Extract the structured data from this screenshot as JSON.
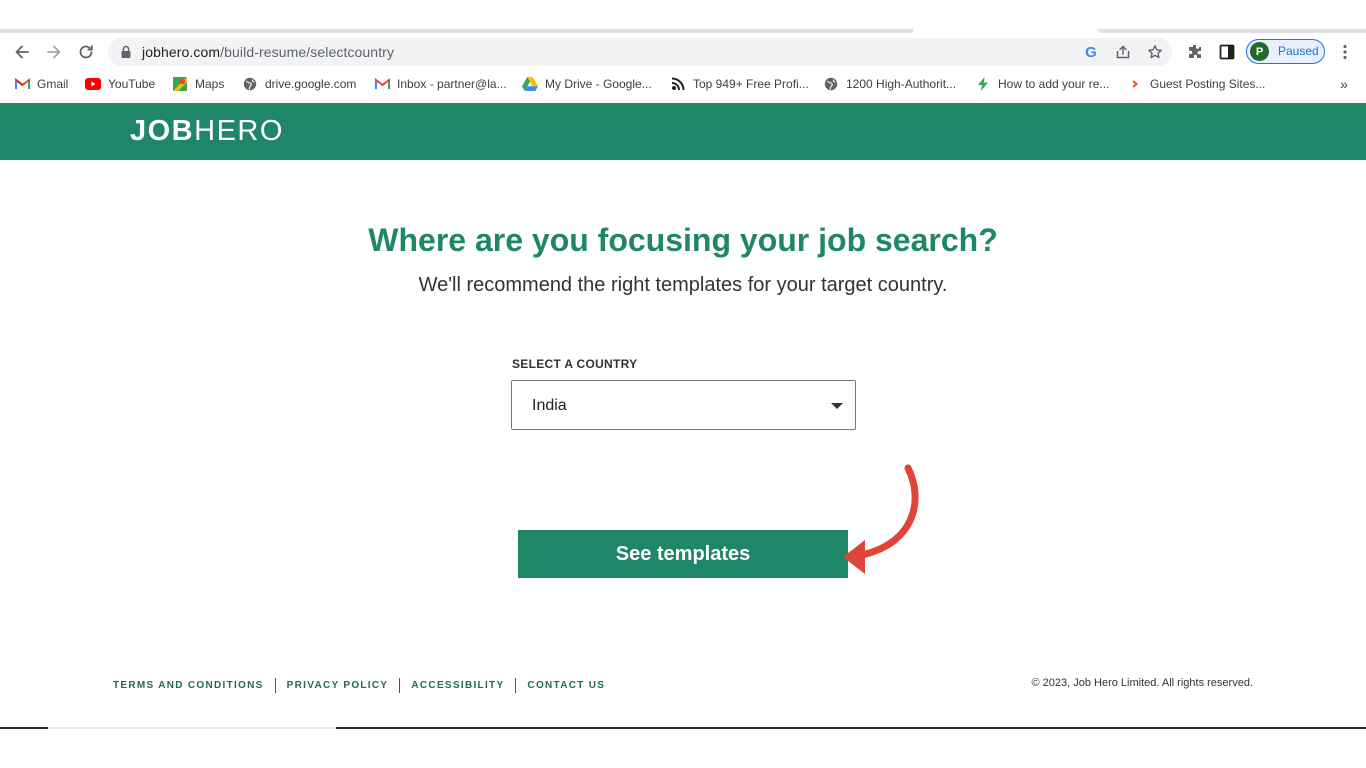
{
  "browser": {
    "url_host": "jobhero.com",
    "url_path": "/build-resume/selectcountry",
    "profile": {
      "initial": "P",
      "status": "Paused"
    },
    "bookmarks": [
      {
        "label": "Gmail",
        "icon": "gmail-icon"
      },
      {
        "label": "YouTube",
        "icon": "youtube-icon"
      },
      {
        "label": "Maps",
        "icon": "maps-icon"
      },
      {
        "label": "drive.google.com",
        "icon": "globe-icon"
      },
      {
        "label": "Inbox - partner@la...",
        "icon": "gmail-icon"
      },
      {
        "label": "My Drive - Google...",
        "icon": "google-drive-icon"
      },
      {
        "label": "Top 949+ Free Profi...",
        "icon": "rss-icon"
      },
      {
        "label": "1200 High-Authorit...",
        "icon": "globe-icon"
      },
      {
        "label": "How to add your re...",
        "icon": "bolt-icon"
      },
      {
        "label": "Guest Posting Sites...",
        "icon": "chevron-orange-icon"
      }
    ],
    "bookmarks_more": "»"
  },
  "site": {
    "logo_bold": "JOB",
    "logo_light": "HERO",
    "brand_color": "#1f8767",
    "headline": "Where are you focusing your job search?",
    "subheadline": "We'll recommend the right templates for your target country.",
    "country_label": "SELECT A COUNTRY",
    "country_value": "India",
    "cta_label": "See templates",
    "annotation_arrow_color": "#e0453a",
    "footer": {
      "links": [
        "TERMS AND CONDITIONS",
        "PRIVACY POLICY",
        "ACCESSIBILITY",
        "CONTACT US"
      ],
      "copyright": "© 2023, Job Hero Limited. All rights reserved."
    }
  }
}
